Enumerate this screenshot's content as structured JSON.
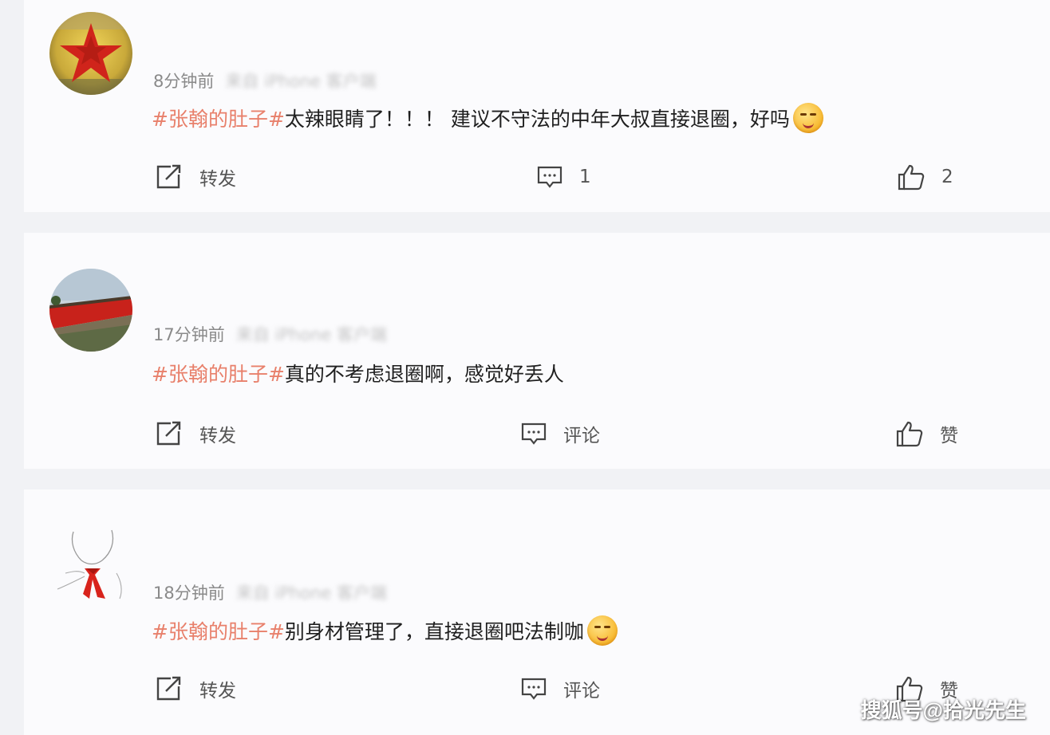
{
  "comments": [
    {
      "time": "8分钟前",
      "source": "来自 iPhone 客户端",
      "hashtag": "#张翰的肚子#",
      "text": "太辣眼睛了！！！ 建议不守法的中年大叔直接退圈，好吗",
      "has_emoji": true,
      "repost_label": "转发",
      "comment_label": "1",
      "like_label": "2"
    },
    {
      "time": "17分钟前",
      "source": "来自 iPhone 客户端",
      "hashtag": "#张翰的肚子#",
      "text": "真的不考虑退圈啊，感觉好丢人",
      "has_emoji": false,
      "repost_label": "转发",
      "comment_label": "评论",
      "like_label": "赞"
    },
    {
      "time": "18分钟前",
      "source": "来自 iPhone 客户端",
      "hashtag": "#张翰的肚子#",
      "text": "别身材管理了，直接退圈吧法制咖",
      "has_emoji": true,
      "repost_label": "转发",
      "comment_label": "评论",
      "like_label": "赞"
    }
  ],
  "icons": {
    "repost": "repost-icon",
    "comment": "comment-icon",
    "like": "thumbs-up-icon",
    "emoji": "smirk-emoji-icon"
  },
  "watermark": "搜狐号@拾光先生",
  "colors": {
    "hashtag": "#e8806b",
    "card_bg": "#fbfbfd",
    "page_bg": "#f1f2f5"
  }
}
